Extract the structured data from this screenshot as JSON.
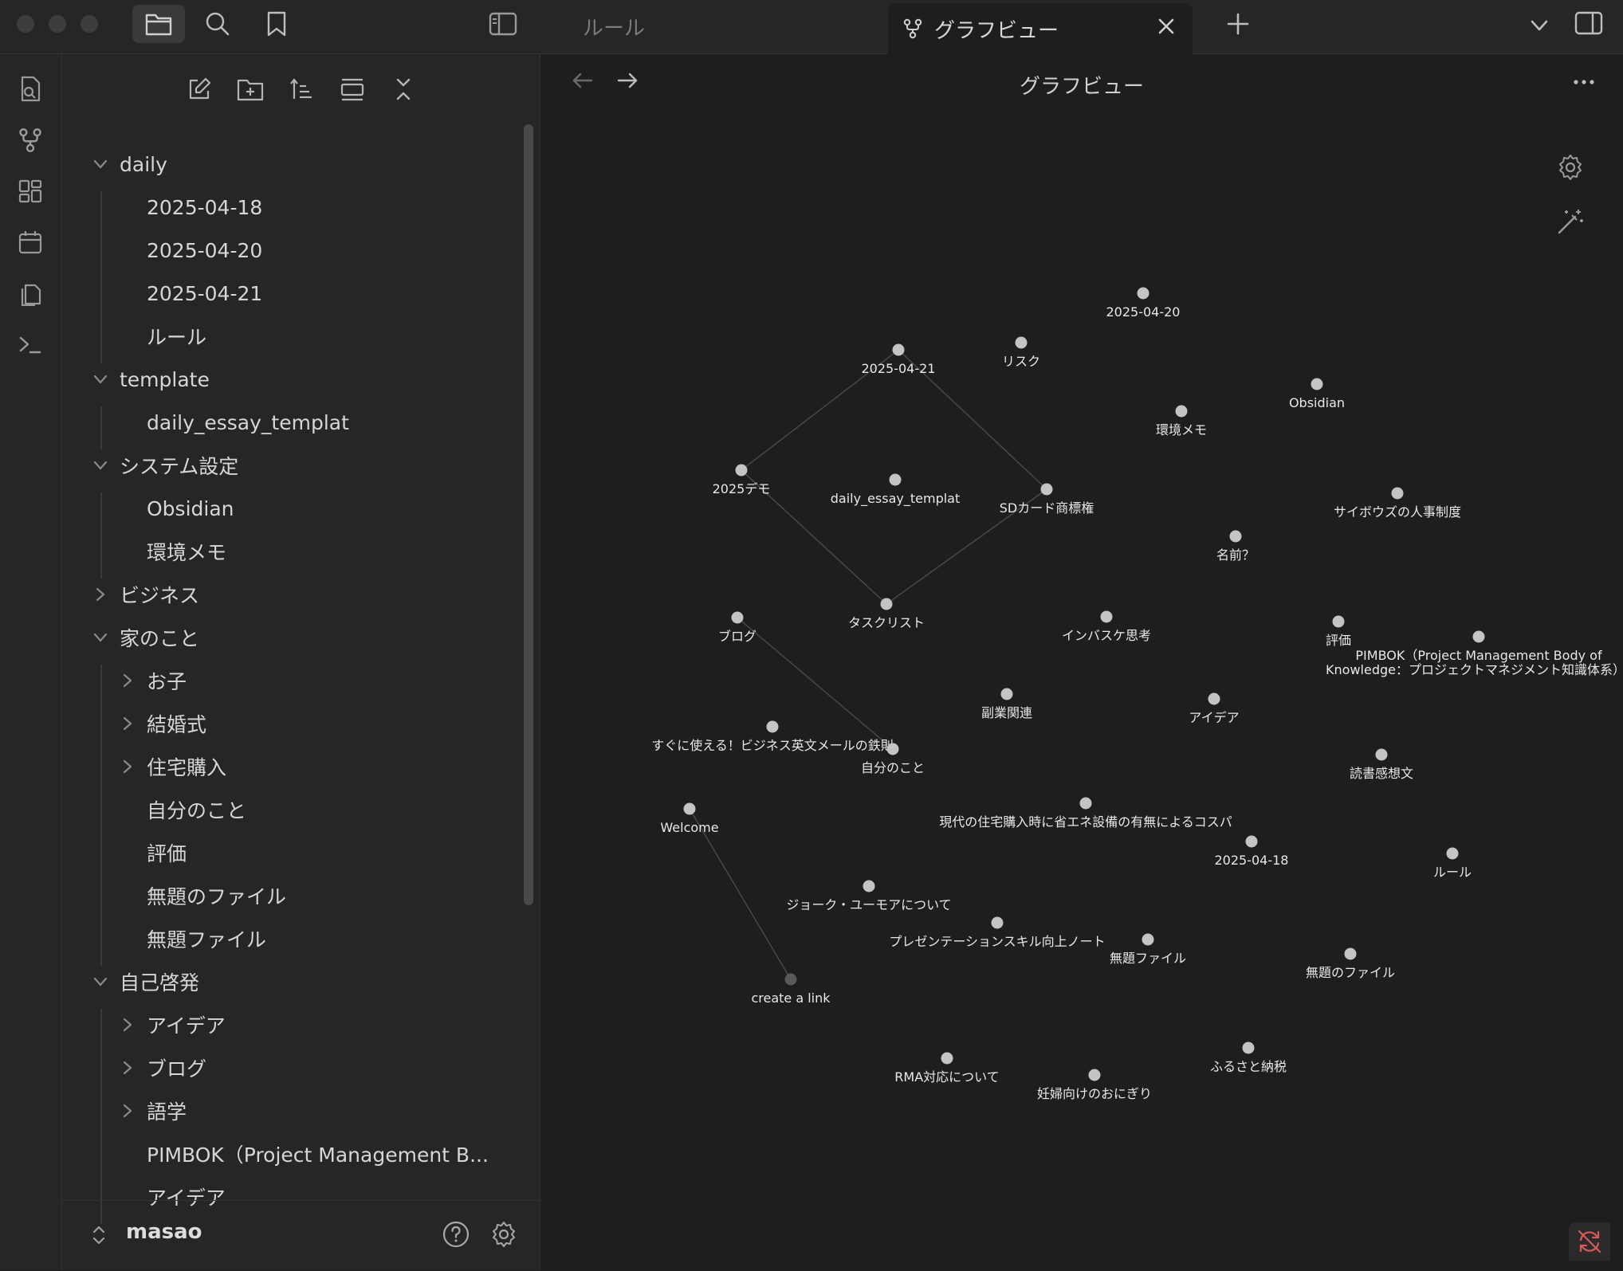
{
  "tabs": {
    "inactive_label": "ルール",
    "active_label": "グラフビュー"
  },
  "sidebar": {
    "tree": [
      {
        "label": "daily",
        "type": "folder",
        "depth": 0,
        "expanded": true
      },
      {
        "label": "2025-04-18",
        "type": "file",
        "depth": 1
      },
      {
        "label": "2025-04-20",
        "type": "file",
        "depth": 1
      },
      {
        "label": "2025-04-21",
        "type": "file",
        "depth": 1
      },
      {
        "label": "ルール",
        "type": "file",
        "depth": 1
      },
      {
        "label": "template",
        "type": "folder",
        "depth": 0,
        "expanded": true
      },
      {
        "label": "daily_essay_templat",
        "type": "file",
        "depth": 1
      },
      {
        "label": "システム設定",
        "type": "folder",
        "depth": 0,
        "expanded": true
      },
      {
        "label": "Obsidian",
        "type": "file",
        "depth": 1
      },
      {
        "label": "環境メモ",
        "type": "file",
        "depth": 1
      },
      {
        "label": "ビジネス",
        "type": "folder",
        "depth": 0,
        "expanded": false
      },
      {
        "label": "家のこと",
        "type": "folder",
        "depth": 0,
        "expanded": true
      },
      {
        "label": "お子",
        "type": "folder",
        "depth": 1,
        "expanded": false
      },
      {
        "label": "結婚式",
        "type": "folder",
        "depth": 1,
        "expanded": false
      },
      {
        "label": "住宅購入",
        "type": "folder",
        "depth": 1,
        "expanded": false
      },
      {
        "label": "自分のこと",
        "type": "file",
        "depth": 1
      },
      {
        "label": "評価",
        "type": "file",
        "depth": 1
      },
      {
        "label": "無題のファイル",
        "type": "file",
        "depth": 1
      },
      {
        "label": "無題ファイル",
        "type": "file",
        "depth": 1
      },
      {
        "label": "自己啓発",
        "type": "folder",
        "depth": 0,
        "expanded": true
      },
      {
        "label": "アイデア",
        "type": "folder",
        "depth": 1,
        "expanded": false
      },
      {
        "label": "ブログ",
        "type": "folder",
        "depth": 1,
        "expanded": false
      },
      {
        "label": "語学",
        "type": "folder",
        "depth": 1,
        "expanded": false
      },
      {
        "label": "PIMBOK（Project Management B...",
        "type": "file",
        "depth": 1
      },
      {
        "label": "アイデア",
        "type": "file",
        "depth": 1
      }
    ],
    "vault_name": "masao"
  },
  "graph": {
    "title": "グラフビュー",
    "nodes": [
      {
        "id": "n1",
        "label": "2025-04-20"
      },
      {
        "id": "n2",
        "label": "2025-04-21"
      },
      {
        "id": "n3",
        "label": "リスク"
      },
      {
        "id": "n4",
        "label": "Obsidian"
      },
      {
        "id": "n5",
        "label": "環境メモ"
      },
      {
        "id": "n6",
        "label": "2025デモ"
      },
      {
        "id": "n7",
        "label": "daily_essay_templat"
      },
      {
        "id": "n8",
        "label": "SDカード商標権"
      },
      {
        "id": "n9",
        "label": "サイボウズの人事制度"
      },
      {
        "id": "n10",
        "label": "名前？"
      },
      {
        "id": "n11",
        "label": "タスクリスト"
      },
      {
        "id": "n12",
        "label": "ブログ"
      },
      {
        "id": "n13",
        "label": "インバスケ思考"
      },
      {
        "id": "n14",
        "label": "評価"
      },
      {
        "id": "n15",
        "label": "PIMBOK（Project Management Body of",
        "label2": "Knowledge：プロジェクトマネジメント知識体系）"
      },
      {
        "id": "n16",
        "label": "副業関連"
      },
      {
        "id": "n17",
        "label": "アイデア"
      },
      {
        "id": "n18",
        "label": "すぐに使える！ビジネス英文メールの鉄則"
      },
      {
        "id": "n19",
        "label": "自分のこと"
      },
      {
        "id": "n20",
        "label": "読書感想文"
      },
      {
        "id": "n21",
        "label": "Welcome"
      },
      {
        "id": "n22",
        "label": "現代の住宅購入時に省エネ設備の有無によるコスパ"
      },
      {
        "id": "n23",
        "label": "2025-04-18"
      },
      {
        "id": "n24",
        "label": "ルール"
      },
      {
        "id": "n25",
        "label": "ジョーク・ユーモアについて"
      },
      {
        "id": "n26",
        "label": "プレゼンテーションスキル向上ノート"
      },
      {
        "id": "n27",
        "label": "無題ファイル"
      },
      {
        "id": "n28",
        "label": "無題のファイル"
      },
      {
        "id": "n29",
        "label": "create a link",
        "unresolved": true
      },
      {
        "id": "n30",
        "label": "RMA対応について"
      },
      {
        "id": "n31",
        "label": "妊婦向けのおにぎり"
      },
      {
        "id": "n32",
        "label": "ふるさと納税"
      }
    ],
    "links": [
      [
        "n2",
        "n6"
      ],
      [
        "n2",
        "n8"
      ],
      [
        "n6",
        "n11"
      ],
      [
        "n8",
        "n11"
      ],
      [
        "n12",
        "n19"
      ],
      [
        "n21",
        "n29"
      ]
    ]
  }
}
